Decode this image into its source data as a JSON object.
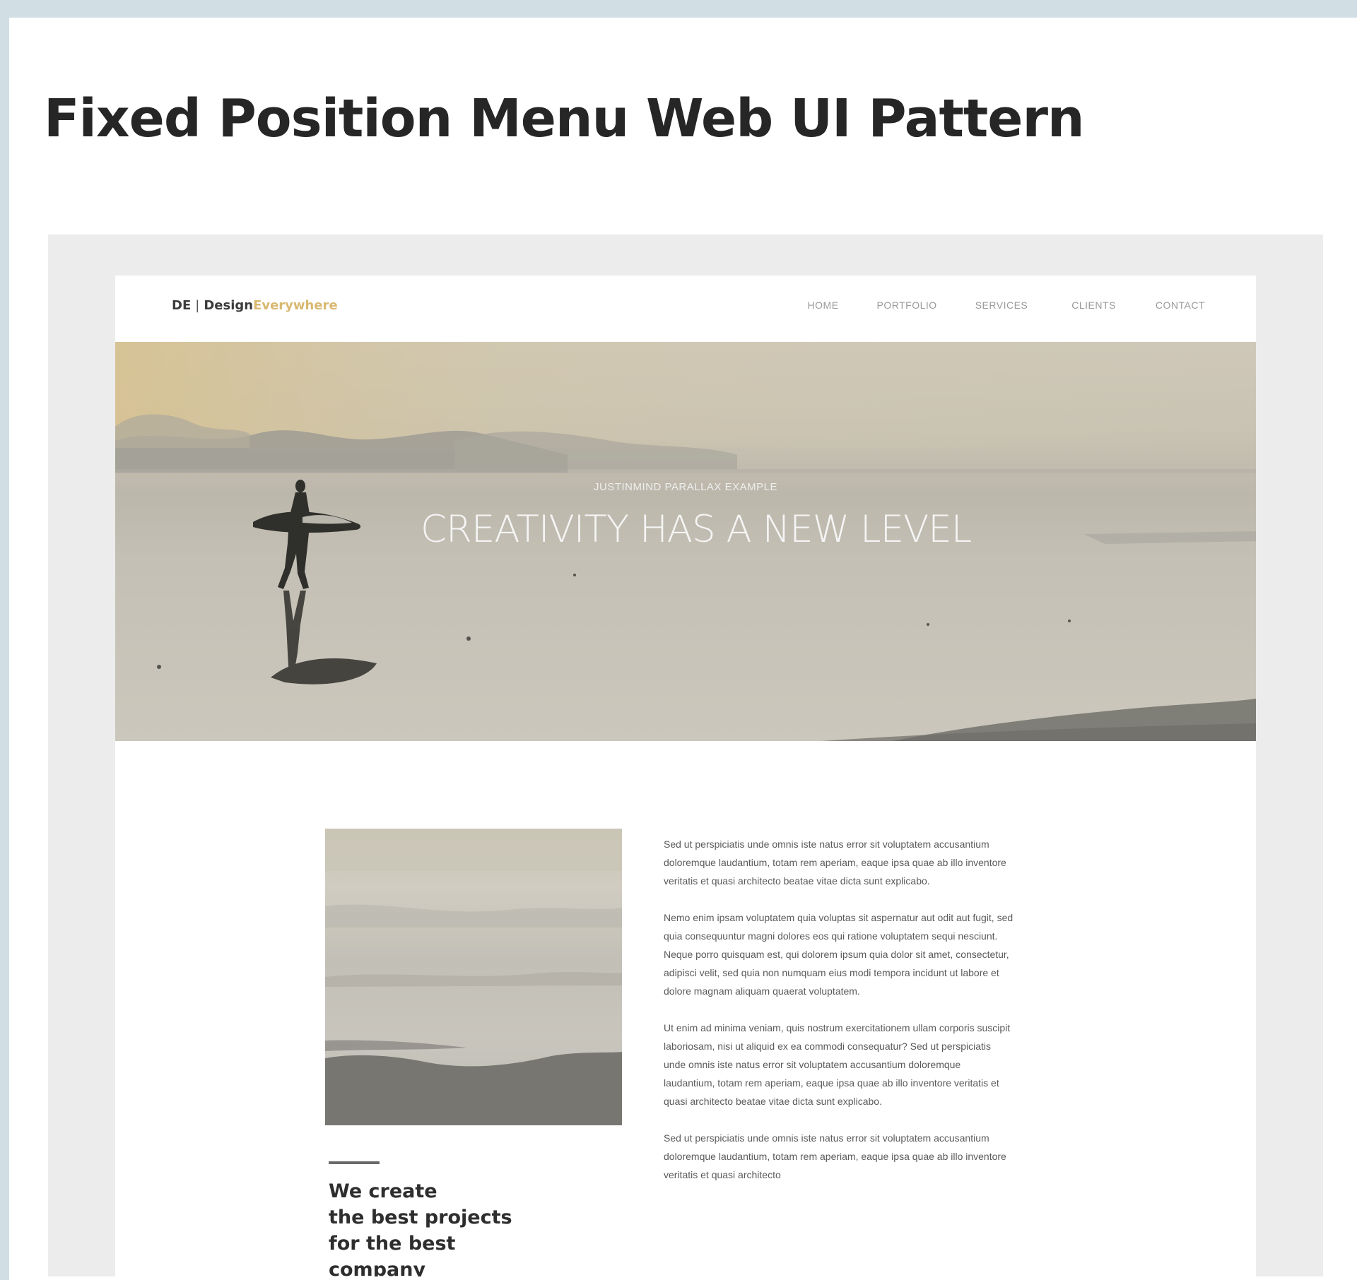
{
  "page": {
    "title": "Fixed Position Menu Web UI Pattern"
  },
  "site": {
    "logo": {
      "mark": "DE",
      "separator": "|",
      "brand_primary": "Design",
      "brand_accent": "Everywhere"
    },
    "nav": {
      "items": [
        {
          "label": "HOME"
        },
        {
          "label": "PORTFOLIO"
        },
        {
          "label": "SERVICES"
        },
        {
          "label": "CLIENTS"
        },
        {
          "label": "CONTACT"
        }
      ]
    },
    "hero": {
      "kicker": "JUSTINMIND PARALLAX EXAMPLE",
      "headline": "CREATIVITY HAS A NEW LEVEL"
    },
    "content": {
      "tagline_lines": [
        "We create",
        "the best projects",
        "for the best",
        "company"
      ],
      "paragraphs": [
        "Sed ut perspiciatis unde omnis iste natus error sit voluptatem accusantium doloremque laudantium, totam rem aperiam, eaque ipsa quae ab illo inventore veritatis et quasi architecto beatae vitae dicta sunt explicabo.",
        "Nemo enim ipsam voluptatem quia voluptas sit aspernatur aut odit aut fugit, sed quia consequuntur magni dolores eos qui ratione voluptatem sequi nesciunt. Neque porro quisquam est, qui dolorem ipsum quia dolor sit amet, consectetur, adipisci velit, sed quia non numquam eius modi tempora incidunt ut labore et dolore magnam aliquam quaerat voluptatem.",
        "Ut enim ad minima veniam, quis nostrum exercitationem ullam corporis suscipit laboriosam, nisi ut aliquid ex ea commodi consequatur? Sed ut perspiciatis unde omnis iste natus error sit voluptatem accusantium doloremque laudantium, totam rem aperiam, eaque ipsa quae ab illo inventore veritatis et quasi architecto beatae vitae dicta sunt explicabo.",
        "Sed ut perspiciatis unde omnis iste natus error sit voluptatem accusantium doloremque laudantium, totam rem aperiam, eaque ipsa quae ab illo inventore veritatis et quasi architecto"
      ]
    }
  },
  "colors": {
    "outer_background": "#d1dfe5",
    "frame_background": "#ececec",
    "brand_accent": "#d9b870",
    "title_text": "#262626"
  },
  "icons": [
    "surfer-silhouette-image",
    "beach-photo-image"
  ]
}
